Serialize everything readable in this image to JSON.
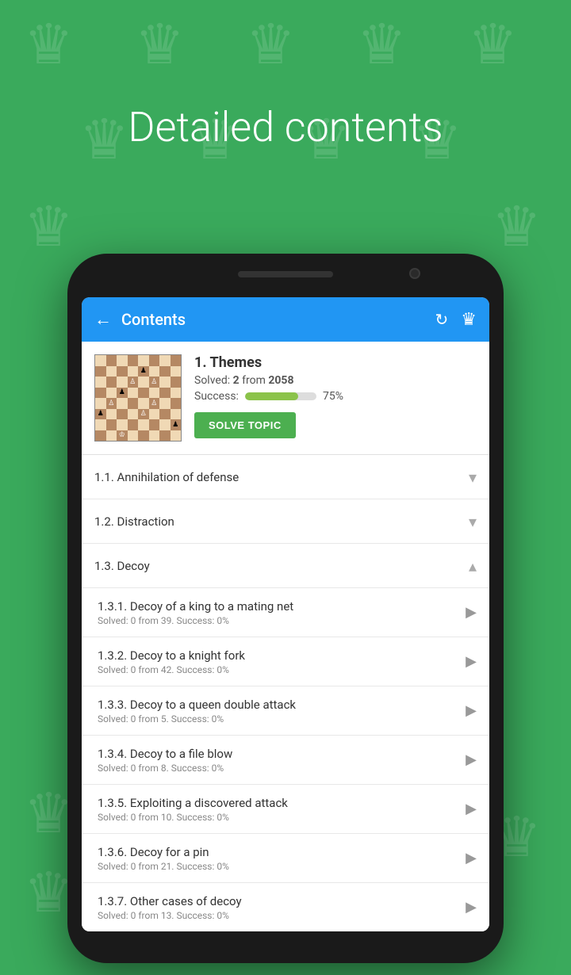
{
  "background": {
    "color": "#3aaa5c"
  },
  "page_title": "Detailed contents",
  "app_bar": {
    "title": "Contents",
    "back_label": "←",
    "refresh_icon": "↻",
    "crown_icon": "♛"
  },
  "topic": {
    "title": "1. Themes",
    "solved_label": "Solved:",
    "solved_count": "2",
    "solved_from": "from",
    "solved_total": "2058",
    "success_label": "Success:",
    "success_pct": 75,
    "success_pct_label": "75%",
    "solve_button": "SOLVE TOPIC"
  },
  "sections": [
    {
      "id": "1.1",
      "title": "1.1. Annihilation of defense",
      "type": "collapsed",
      "sub_items": []
    },
    {
      "id": "1.2",
      "title": "1.2. Distraction",
      "type": "collapsed",
      "sub_items": []
    },
    {
      "id": "1.3",
      "title": "1.3. Decoy",
      "type": "expanded",
      "sub_items": [
        {
          "id": "1.3.1",
          "title": "1.3.1. Decoy of a king to a mating net",
          "subtitle": "Solved: 0 from 39. Success: 0%"
        },
        {
          "id": "1.3.2",
          "title": "1.3.2. Decoy to a knight fork",
          "subtitle": "Solved: 0 from 42. Success: 0%"
        },
        {
          "id": "1.3.3",
          "title": "1.3.3. Decoy to a queen double attack",
          "subtitle": "Solved: 0 from 5. Success: 0%"
        },
        {
          "id": "1.3.4",
          "title": "1.3.4. Decoy to a file blow",
          "subtitle": "Solved: 0 from 8. Success: 0%"
        },
        {
          "id": "1.3.5",
          "title": "1.3.5. Exploiting a discovered attack",
          "subtitle": "Solved: 0 from 10. Success: 0%"
        },
        {
          "id": "1.3.6",
          "title": "1.3.6. Decoy for a pin",
          "subtitle": "Solved: 0 from 21. Success: 0%"
        },
        {
          "id": "1.3.7",
          "title": "1.3.7. Other cases of decoy",
          "subtitle": "Solved: 0 from 13. Success: 0%"
        }
      ]
    }
  ]
}
